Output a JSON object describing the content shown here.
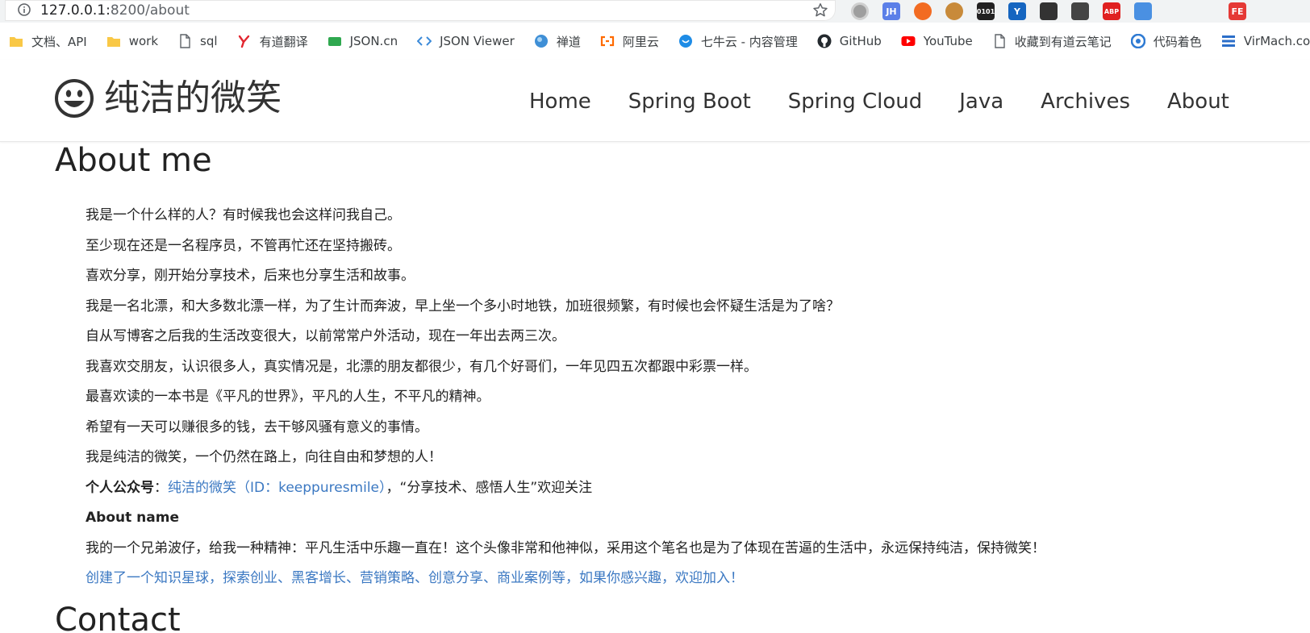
{
  "browser": {
    "url_host": "127.0.0.1:",
    "url_path": "8200/about",
    "extensions": [
      {
        "name": "circle-extension-icon",
        "color": "#9e9e9e",
        "text": ""
      },
      {
        "name": "jh-extension-icon",
        "color": "#5b7fe8",
        "text": "JH"
      },
      {
        "name": "lifebuoy-extension-icon",
        "color": "#f26b22",
        "text": ""
      },
      {
        "name": "cookie-extension-icon",
        "color": "#c88a3a",
        "text": ""
      },
      {
        "name": "binary-extension-icon",
        "color": "#222222",
        "text": "0101"
      },
      {
        "name": "y-extension-icon",
        "color": "#1565c0",
        "text": "Y"
      },
      {
        "name": "tampermonkey-extension-icon",
        "color": "#333333",
        "text": ""
      },
      {
        "name": "download-extension-icon",
        "color": "#444444",
        "text": ""
      },
      {
        "name": "adblock-extension-icon",
        "color": "#e02020",
        "text": "ABP"
      },
      {
        "name": "grid-extension-icon",
        "color": "#4a90e2",
        "text": ""
      },
      {
        "name": "check-extension-icon",
        "color": "#bbbbbb",
        "text": ""
      },
      {
        "name": "vue-extension-icon",
        "color": "#aaaaaa",
        "text": ""
      },
      {
        "name": "fe-extension-icon",
        "color": "#e53935",
        "text": "FE"
      },
      {
        "name": "tree-extension-icon",
        "color": "#aaaaaa",
        "text": ""
      }
    ],
    "bookmarks": [
      {
        "label": "文档、API",
        "icon": "folder-icon"
      },
      {
        "label": "work",
        "icon": "folder-icon"
      },
      {
        "label": "sql",
        "icon": "page-icon"
      },
      {
        "label": "有道翻译",
        "icon": "youdao-icon"
      },
      {
        "label": "JSON.cn",
        "icon": "json-icon"
      },
      {
        "label": "JSON Viewer",
        "icon": "json-viewer-icon"
      },
      {
        "label": "禅道",
        "icon": "zentao-icon"
      },
      {
        "label": "阿里云",
        "icon": "aliyun-icon"
      },
      {
        "label": "七牛云 - 内容管理",
        "icon": "qiniu-icon"
      },
      {
        "label": "GitHub",
        "icon": "github-icon"
      },
      {
        "label": "YouTube",
        "icon": "youtube-icon"
      },
      {
        "label": "收藏到有道云笔记",
        "icon": "page-icon"
      },
      {
        "label": "代码着色",
        "icon": "code-color-icon"
      },
      {
        "label": "VirMach.com",
        "icon": "virmach-icon"
      }
    ]
  },
  "site": {
    "brand": "纯洁的微笑",
    "nav": [
      "Home",
      "Spring Boot",
      "Spring Cloud",
      "Java",
      "Archives",
      "About"
    ]
  },
  "about": {
    "heading": "About me",
    "lines": [
      "我是一个什么样的人？有时候我也会这样问我自己。",
      "至少现在还是一名程序员，不管再忙还在坚持搬砖。",
      "喜欢分享，刚开始分享技术，后来也分享生活和故事。",
      "我是一名北漂，和大多数北漂一样，为了生计而奔波，早上坐一个多小时地铁，加班很频繁，有时候也会怀疑生活是为了啥？",
      "自从写博客之后我的生活改变很大，以前常常户外活动，现在一年出去两三次。",
      "我喜欢交朋友，认识很多人，真实情况是，北漂的朋友都很少，有几个好哥们，一年见四五次都跟中彩票一样。",
      "最喜欢读的一本书是《平凡的世界》，平凡的人生，不平凡的精神。",
      "希望有一天可以赚很多的钱，去干够风骚有意义的事情。",
      "我是纯洁的微笑，一个仍然在路上，向往自由和梦想的人！"
    ],
    "wechat_label": "个人公众号",
    "wechat_colon": "：",
    "wechat_link": "纯洁的微笑（ID：keeppuresmile）",
    "wechat_tail": "，“分享技术、感悟人生”欢迎关注",
    "name_heading": "About name",
    "name_text": "我的一个兄弟波仔，给我一种精神：平凡生活中乐趣一直在！这个头像非常和他神似，采用这个笔名也是为了体现在苦逼的生活中，永远保持纯洁，保持微笑！",
    "planet_link": "创建了一个知识星球，探索创业、黑客增长、营销策略、创意分享、商业案例等，如果你感兴趣，欢迎加入！"
  },
  "contact": {
    "heading": "Contact"
  },
  "colors": {
    "link": "#3b78c2",
    "text": "#222222",
    "nav_text": "#333333"
  }
}
